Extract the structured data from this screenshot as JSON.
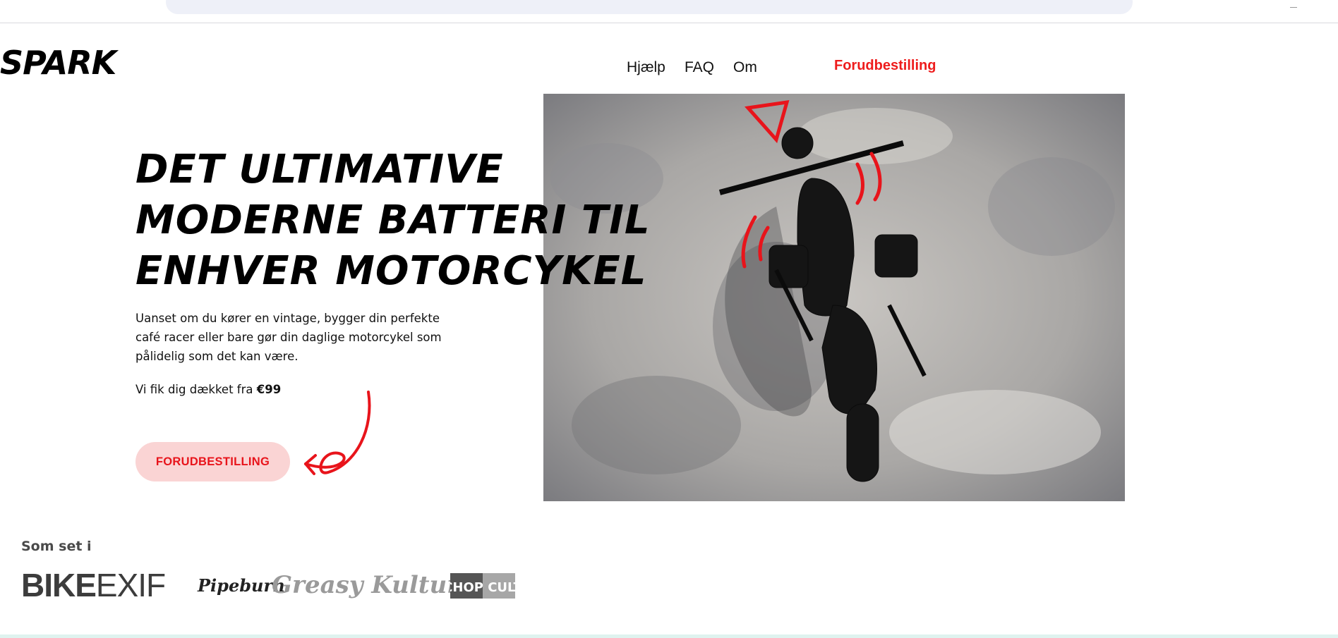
{
  "brand": {
    "logo_text": "SPARK"
  },
  "nav": {
    "links": [
      "Hjælp",
      "FAQ",
      "Om"
    ],
    "cta": "Forudbestilling"
  },
  "hero": {
    "headline_lines": [
      "DET ULTIMATIVE",
      "MODERNE BATTERI TIL",
      "ENHVER MOTORCYKEL"
    ],
    "description": "Uanset om du kører en vintage, bygger din perfekte café racer eller bare gør din daglige motorcykel som pålidelig som det kan være.",
    "price_prefix": "Vi fik dig dækket fra ",
    "price": "€99",
    "cta_button": "FORUDBESTILLING"
  },
  "press": {
    "label": "Som set i",
    "logos": {
      "bikeexif_bold": "BIKE",
      "bikeexif_light": "EXIF",
      "pipeburn": "Pipeburn",
      "greasy_kulture": "Greasy Kulture",
      "chop_cult": "CHOP CULT"
    }
  },
  "colors": {
    "accent": "#ee1c1c",
    "button_bg": "#fad4d4",
    "text": "#111111"
  },
  "icons": {
    "hero_image": "motorcycle-photo",
    "doodle": "curly-arrow-icon"
  }
}
